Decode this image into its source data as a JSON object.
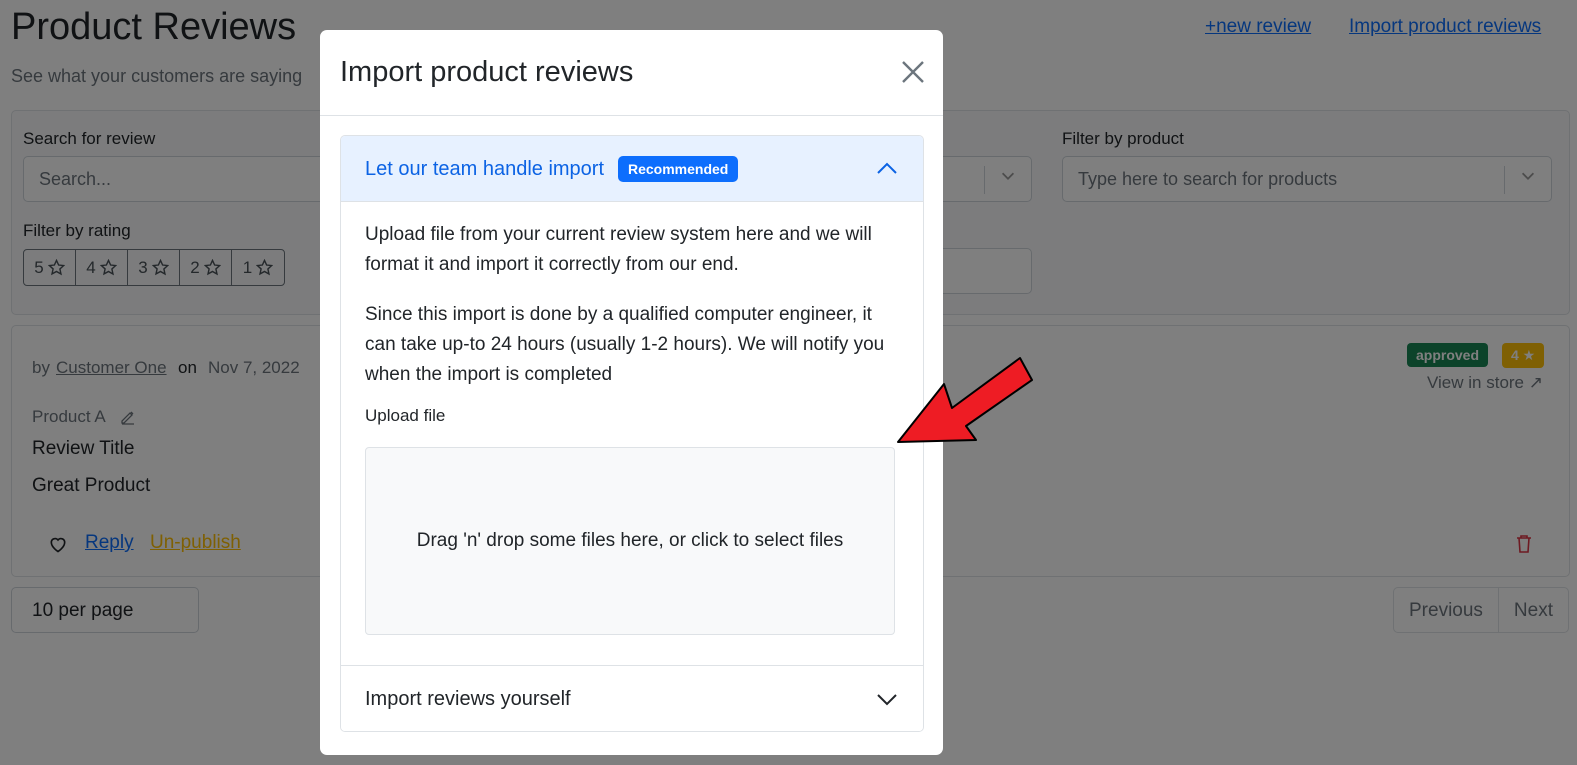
{
  "page": {
    "title": "Product Reviews",
    "subtitle": "See what your customers are saying",
    "links": {
      "new_review": "+new review",
      "import_reviews": "Import product reviews"
    }
  },
  "filters": {
    "search_label": "Search for review",
    "search_placeholder": "Search...",
    "product_label": "Filter by product",
    "product_placeholder": "Type here to search for products",
    "rating_label": "Filter by rating",
    "ratings": [
      "5",
      "4",
      "3",
      "2",
      "1"
    ]
  },
  "review": {
    "by": "by",
    "customer": "Customer One",
    "on": "on",
    "date": "Nov 7, 2022",
    "product": "Product A",
    "title": "Review Title",
    "body": "Great Product",
    "reply": "Reply",
    "unpublish": "Un-publish",
    "status_badge": "approved",
    "rating_badge": "4",
    "view_in_store": "View in store",
    "colors": {
      "approved": "#198754",
      "rating": "#ffc107",
      "unpublish": "#ffc107",
      "delete": "#dc3545"
    }
  },
  "pagination": {
    "page_size": "10 per page",
    "previous": "Previous",
    "next": "Next"
  },
  "modal": {
    "title": "Import product reviews",
    "close_icon": "close-icon",
    "section1": {
      "title": "Let our team handle import",
      "badge": "Recommended",
      "para1": "Upload file from your current review system here and we will format it and import it correctly from our end.",
      "para2": "Since this import is done by a qualified computer engineer, it can take up-to 24 hours (usually 1-2 hours). We will notify you when the import is completed",
      "upload_label": "Upload file",
      "dropzone_text": "Drag 'n' drop some files here, or click to select files"
    },
    "section2": {
      "title": "Import reviews yourself"
    }
  },
  "annotation": {
    "arrow_color": "#ee1c24"
  }
}
